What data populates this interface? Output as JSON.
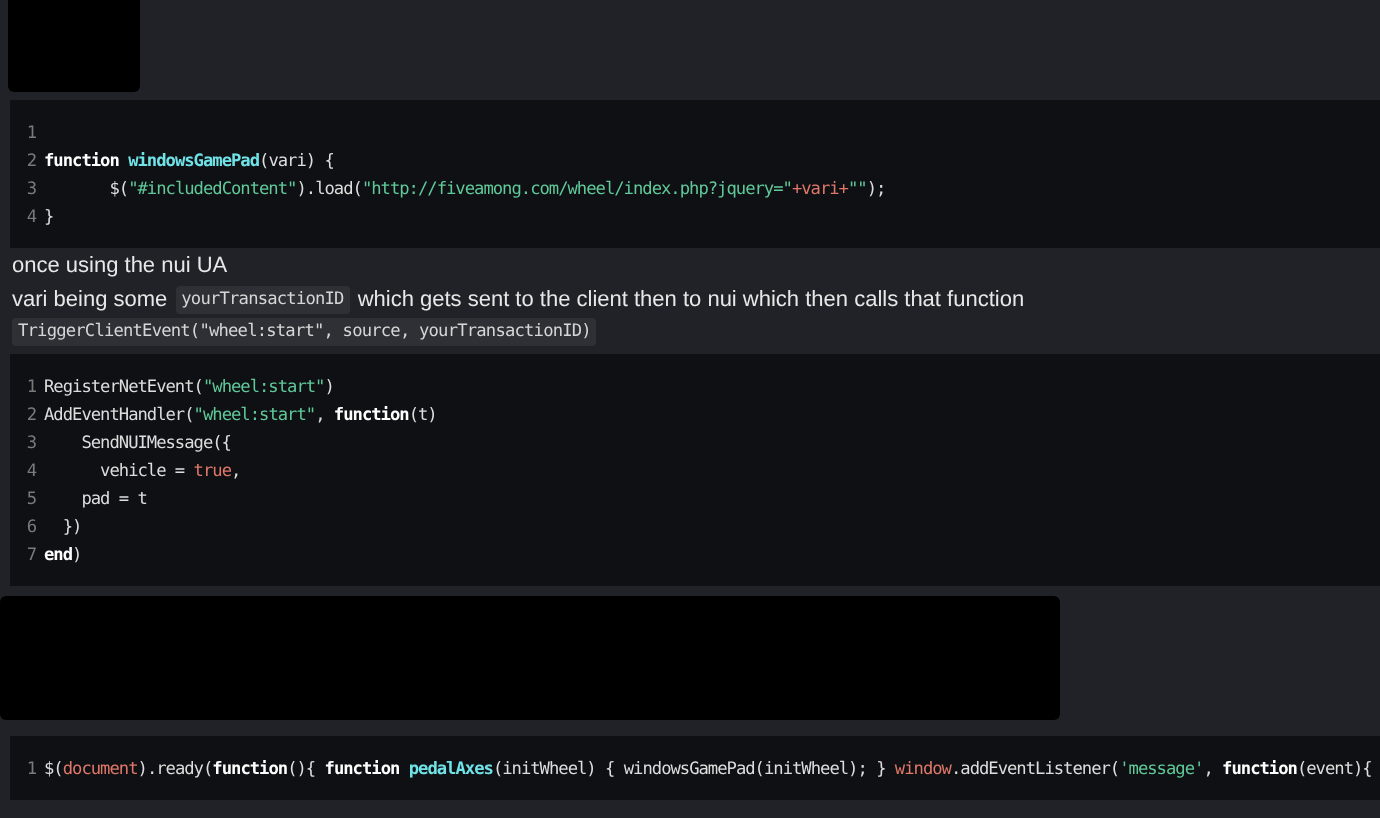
{
  "blocks": [
    {
      "kind": "redacted"
    },
    {
      "kind": "code",
      "lines": [
        {
          "number": "1"
        },
        {
          "number": "2",
          "tokens": [
            {
              "kind": "keyword",
              "text": "function "
            },
            {
              "kind": "title",
              "text": "windowsGamePad"
            },
            {
              "kind": "text",
              "text": "(vari) {"
            }
          ]
        },
        {
          "number": "3",
          "tokens": [
            {
              "kind": "text",
              "text": "       $("
            },
            {
              "kind": "string",
              "text": "\"#includedContent\""
            },
            {
              "kind": "text",
              "text": ").load("
            },
            {
              "kind": "string",
              "text": "\"http://fiveamong.com/wheel/index.php?jquery=\""
            },
            {
              "kind": "literal",
              "text": "+vari+"
            },
            {
              "kind": "string",
              "text": "\"\""
            },
            {
              "kind": "text",
              "text": ");"
            }
          ]
        },
        {
          "number": "4",
          "tokens": [
            {
              "kind": "text",
              "text": "}"
            }
          ]
        }
      ]
    },
    {
      "kind": "paragraph",
      "parts": [
        {
          "kind": "text",
          "text": "once using the nui UA"
        }
      ]
    },
    {
      "kind": "paragraph",
      "parts": [
        {
          "kind": "text",
          "text": "vari being some"
        },
        {
          "kind": "code",
          "text": "yourTransactionID"
        },
        {
          "kind": "text",
          "text": "which gets sent to the client then to nui which then calls that function"
        }
      ]
    },
    {
      "kind": "paragraph",
      "parts": [
        {
          "kind": "code",
          "text": "TriggerClientEvent(\"wheel:start\", source, yourTransactionID)"
        }
      ]
    },
    {
      "kind": "code",
      "lines": [
        {
          "number": "1",
          "tokens": [
            {
              "kind": "text",
              "text": "RegisterNetEvent("
            },
            {
              "kind": "string",
              "text": "\"wheel:start\""
            },
            {
              "kind": "text",
              "text": ")"
            }
          ]
        },
        {
          "number": "2",
          "tokens": [
            {
              "kind": "text",
              "text": "AddEventHandler("
            },
            {
              "kind": "string",
              "text": "\"wheel:start\""
            },
            {
              "kind": "text",
              "text": ", "
            },
            {
              "kind": "keyword",
              "text": "function"
            },
            {
              "kind": "text",
              "text": "(t)"
            }
          ]
        },
        {
          "number": "3",
          "tokens": [
            {
              "kind": "text",
              "text": "    SendNUIMessage({"
            }
          ]
        },
        {
          "number": "4",
          "tokens": [
            {
              "kind": "text",
              "text": "      vehicle = "
            },
            {
              "kind": "literal",
              "text": "true"
            },
            {
              "kind": "text",
              "text": ","
            }
          ]
        },
        {
          "number": "5",
          "tokens": [
            {
              "kind": "text",
              "text": "    pad = t"
            }
          ]
        },
        {
          "number": "6",
          "tokens": [
            {
              "kind": "text",
              "text": "  })"
            }
          ]
        },
        {
          "number": "7",
          "tokens": [
            {
              "kind": "keyword",
              "text": "end"
            },
            {
              "kind": "text",
              "text": ")"
            }
          ]
        }
      ]
    },
    {
      "kind": "redacted_wide"
    },
    {
      "kind": "code",
      "lines": [
        {
          "number": "1",
          "tokens": [
            {
              "kind": "text",
              "text": "$("
            },
            {
              "kind": "literal",
              "text": "document"
            },
            {
              "kind": "text",
              "text": ").ready("
            },
            {
              "kind": "keyword",
              "text": "function"
            },
            {
              "kind": "text",
              "text": "(){ "
            },
            {
              "kind": "keyword",
              "text": "function "
            },
            {
              "kind": "title",
              "text": "pedalAxes"
            },
            {
              "kind": "text",
              "text": "(initWheel) { windowsGamePad(initWheel); } "
            },
            {
              "kind": "literal",
              "text": "window"
            },
            {
              "kind": "text",
              "text": ".addEventListener("
            },
            {
              "kind": "string",
              "text": "'message'"
            },
            {
              "kind": "text",
              "text": ", "
            },
            {
              "kind": "keyword",
              "text": "function"
            },
            {
              "kind": "text",
              "text": "(event){"
            }
          ]
        }
      ]
    }
  ]
}
